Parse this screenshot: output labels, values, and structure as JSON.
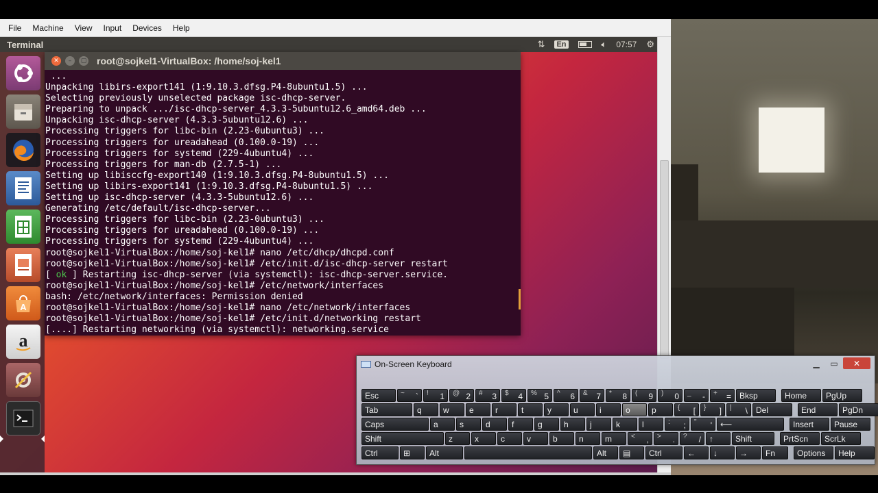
{
  "vbox": {
    "menu": [
      "File",
      "Machine",
      "View",
      "Input",
      "Devices",
      "Help"
    ]
  },
  "topbar": {
    "title": "Terminal",
    "lang": "En",
    "time": "07:57"
  },
  "launcher": {
    "items": [
      "ubuntu-dash-icon",
      "files-icon",
      "firefox-icon",
      "writer-icon",
      "calc-icon",
      "impress-icon",
      "software-center-icon",
      "amazon-icon",
      "system-settings-icon",
      "terminal-icon"
    ]
  },
  "terminal": {
    "title": "root@sojkel1-VirtualBox: /home/soj-kel1",
    "lines": [
      " ...",
      "Unpacking libirs-export141 (1:9.10.3.dfsg.P4-8ubuntu1.5) ...",
      "Selecting previously unselected package isc-dhcp-server.",
      "Preparing to unpack .../isc-dhcp-server_4.3.3-5ubuntu12.6_amd64.deb ...",
      "Unpacking isc-dhcp-server (4.3.3-5ubuntu12.6) ...",
      "Processing triggers for libc-bin (2.23-0ubuntu3) ...",
      "Processing triggers for ureadahead (0.100.0-19) ...",
      "Processing triggers for systemd (229-4ubuntu4) ...",
      "Processing triggers for man-db (2.7.5-1) ...",
      "Setting up libisccfg-export140 (1:9.10.3.dfsg.P4-8ubuntu1.5) ...",
      "Setting up libirs-export141 (1:9.10.3.dfsg.P4-8ubuntu1.5) ...",
      "Setting up isc-dhcp-server (4.3.3-5ubuntu12.6) ...",
      "Generating /etc/default/isc-dhcp-server...",
      "Processing triggers for libc-bin (2.23-0ubuntu3) ...",
      "Processing triggers for ureadahead (0.100.0-19) ...",
      "Processing triggers for systemd (229-4ubuntu4) ...",
      "root@sojkel1-VirtualBox:/home/soj-kel1# nano /etc/dhcp/dhcpd.conf",
      "root@sojkel1-VirtualBox:/home/soj-kel1# /etc/init.d/isc-dhcp-server restart",
      "ok-line",
      "root@sojkel1-VirtualBox:/home/soj-kel1# /etc/network/interfaces",
      "bash: /etc/network/interfaces: Permission denied",
      "root@sojkel1-VirtualBox:/home/soj-kel1# nano /etc/network/interfaces",
      "root@sojkel1-VirtualBox:/home/soj-kel1# /etc/init.d/networking restart",
      "[....] Restarting networking (via systemctl): networking.service"
    ],
    "ok_line": {
      "open": "[ ",
      "ok": "ok",
      "rest": " ] Restarting isc-dhcp-server (via systemctl): isc-dhcp-server.service."
    }
  },
  "osk": {
    "title": "On-Screen Keyboard",
    "rows": [
      [
        {
          "k": "Esc",
          "w": "w50"
        },
        {
          "up": "~",
          "down": "`"
        },
        {
          "up": "!",
          "down": "1"
        },
        {
          "up": "@",
          "down": "2"
        },
        {
          "up": "#",
          "down": "3"
        },
        {
          "up": "$",
          "down": "4"
        },
        {
          "up": "%",
          "down": "5"
        },
        {
          "up": "^",
          "down": "6"
        },
        {
          "up": "&",
          "down": "7"
        },
        {
          "up": "*",
          "down": "8"
        },
        {
          "up": "(",
          "down": "9"
        },
        {
          "up": ")",
          "down": "0"
        },
        {
          "up": "_",
          "down": "-"
        },
        {
          "up": "+",
          "down": "="
        },
        {
          "k": "Bksp",
          "w": "w58"
        },
        {
          "k": "Home",
          "w": "w58",
          "nav": true
        },
        {
          "k": "PgUp",
          "w": "w58"
        }
      ],
      [
        {
          "k": "Tab",
          "w": "w74"
        },
        {
          "k": "q"
        },
        {
          "k": "w"
        },
        {
          "k": "e"
        },
        {
          "k": "r"
        },
        {
          "k": "t"
        },
        {
          "k": "y"
        },
        {
          "k": "u"
        },
        {
          "k": "i"
        },
        {
          "k": "o",
          "hl": true
        },
        {
          "k": "p"
        },
        {
          "up": "{",
          "down": "["
        },
        {
          "up": "}",
          "down": "]"
        },
        {
          "up": "|",
          "down": "\\"
        },
        {
          "k": "Del",
          "w": "w58"
        },
        {
          "k": "End",
          "w": "w58",
          "nav": true
        },
        {
          "k": "PgDn",
          "w": "w58"
        }
      ],
      [
        {
          "k": "Caps",
          "w": "w98"
        },
        {
          "k": "a"
        },
        {
          "k": "s"
        },
        {
          "k": "d"
        },
        {
          "k": "f"
        },
        {
          "k": "g"
        },
        {
          "k": "h"
        },
        {
          "k": "j"
        },
        {
          "k": "k"
        },
        {
          "k": "l"
        },
        {
          "up": ":",
          "down": ";"
        },
        {
          "up": "\"",
          "down": "'"
        },
        {
          "k": "⟵",
          "w": "w98"
        },
        {
          "k": "Insert",
          "w": "w58",
          "nav": true
        },
        {
          "k": "Pause",
          "w": "w58"
        }
      ],
      [
        {
          "k": "Shift",
          "w": "w120"
        },
        {
          "k": "z"
        },
        {
          "k": "x"
        },
        {
          "k": "c"
        },
        {
          "k": "v"
        },
        {
          "k": "b"
        },
        {
          "k": "n"
        },
        {
          "k": "m"
        },
        {
          "up": "<",
          "down": ","
        },
        {
          "up": ">",
          "down": "."
        },
        {
          "up": "?",
          "down": "/"
        },
        {
          "k": "↑"
        },
        {
          "k": "Shift",
          "w": "w62"
        },
        {
          "k": "PrtScn",
          "w": "w58",
          "nav": true
        },
        {
          "k": "ScrLk",
          "w": "w58"
        }
      ],
      [
        {
          "k": "Ctrl",
          "w": "w54"
        },
        {
          "k": "⊞"
        },
        {
          "k": "Alt",
          "w": "w54"
        },
        {
          "k": "",
          "w": "w186"
        },
        {
          "k": "Alt",
          "w": "w36"
        },
        {
          "k": "▤"
        },
        {
          "k": "Ctrl",
          "w": "w54"
        },
        {
          "k": "←"
        },
        {
          "k": "↓"
        },
        {
          "k": "→"
        },
        {
          "k": "Fn",
          "w": "w38"
        },
        {
          "k": "Options",
          "w": "w58",
          "nav": true
        },
        {
          "k": "Help",
          "w": "w58"
        }
      ]
    ]
  }
}
